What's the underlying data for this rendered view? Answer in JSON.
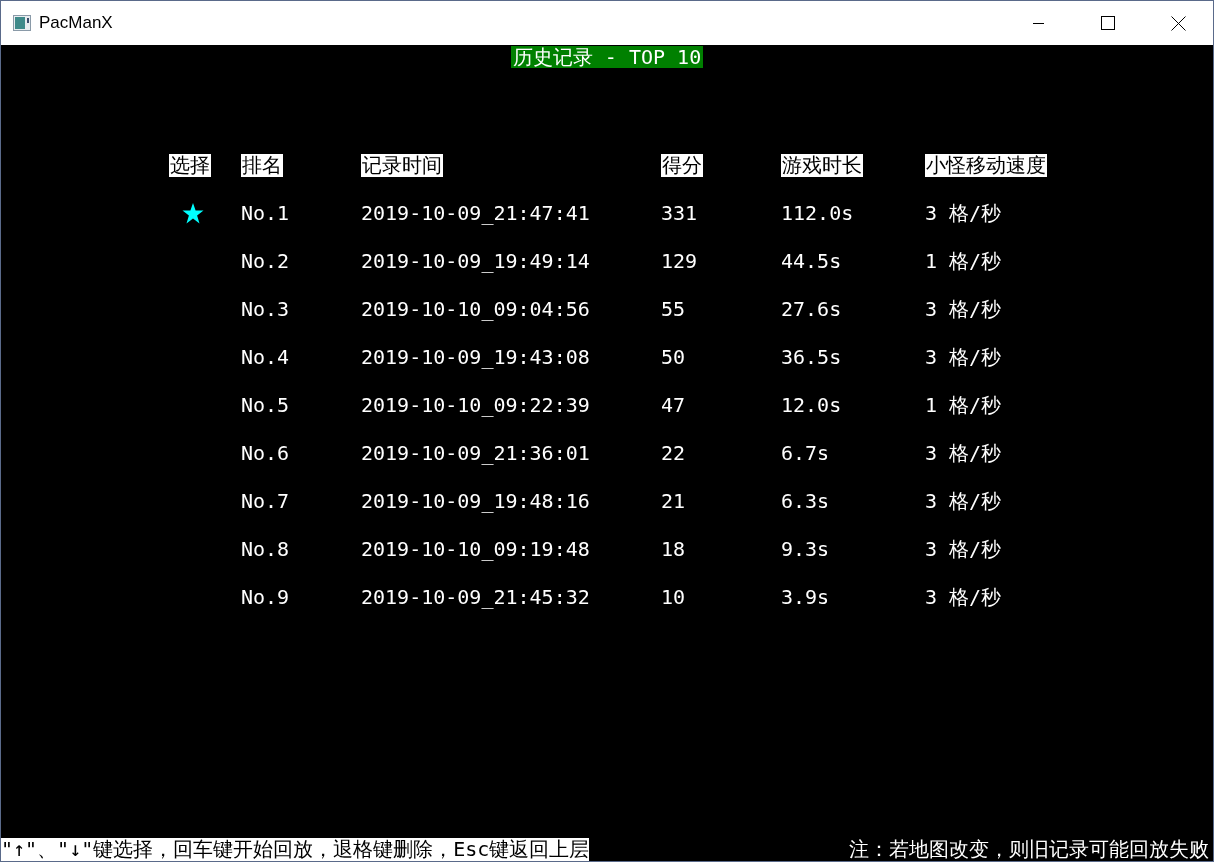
{
  "window": {
    "title": "PacManX"
  },
  "heading": "历史记录 - TOP 10",
  "columns": [
    "选择",
    "排名",
    "记录时间",
    "得分",
    "游戏时长",
    "小怪移动速度"
  ],
  "rows": [
    {
      "selected": true,
      "rank": "No.1",
      "time": "2019-10-09_21:47:41",
      "score": "331",
      "duration": "112.0s",
      "speed": "3 格/秒"
    },
    {
      "selected": false,
      "rank": "No.2",
      "time": "2019-10-09_19:49:14",
      "score": "129",
      "duration": "44.5s",
      "speed": "1 格/秒"
    },
    {
      "selected": false,
      "rank": "No.3",
      "time": "2019-10-10_09:04:56",
      "score": "55",
      "duration": "27.6s",
      "speed": "3 格/秒"
    },
    {
      "selected": false,
      "rank": "No.4",
      "time": "2019-10-09_19:43:08",
      "score": "50",
      "duration": "36.5s",
      "speed": "3 格/秒"
    },
    {
      "selected": false,
      "rank": "No.5",
      "time": "2019-10-10_09:22:39",
      "score": "47",
      "duration": "12.0s",
      "speed": "1 格/秒"
    },
    {
      "selected": false,
      "rank": "No.6",
      "time": "2019-10-09_21:36:01",
      "score": "22",
      "duration": "6.7s",
      "speed": "3 格/秒"
    },
    {
      "selected": false,
      "rank": "No.7",
      "time": "2019-10-09_19:48:16",
      "score": "21",
      "duration": "6.3s",
      "speed": "3 格/秒"
    },
    {
      "selected": false,
      "rank": "No.8",
      "time": "2019-10-10_09:19:48",
      "score": "18",
      "duration": "9.3s",
      "speed": "3 格/秒"
    },
    {
      "selected": false,
      "rank": "No.9",
      "time": "2019-10-09_21:45:32",
      "score": "10",
      "duration": "3.9s",
      "speed": "3 格/秒"
    }
  ],
  "footer": {
    "keys_hint": "\"↑\"、\"↓\"键选择，回车键开始回放，退格键删除，Esc键返回上层",
    "note": "注：若地图改变，则旧记录可能回放失败"
  }
}
